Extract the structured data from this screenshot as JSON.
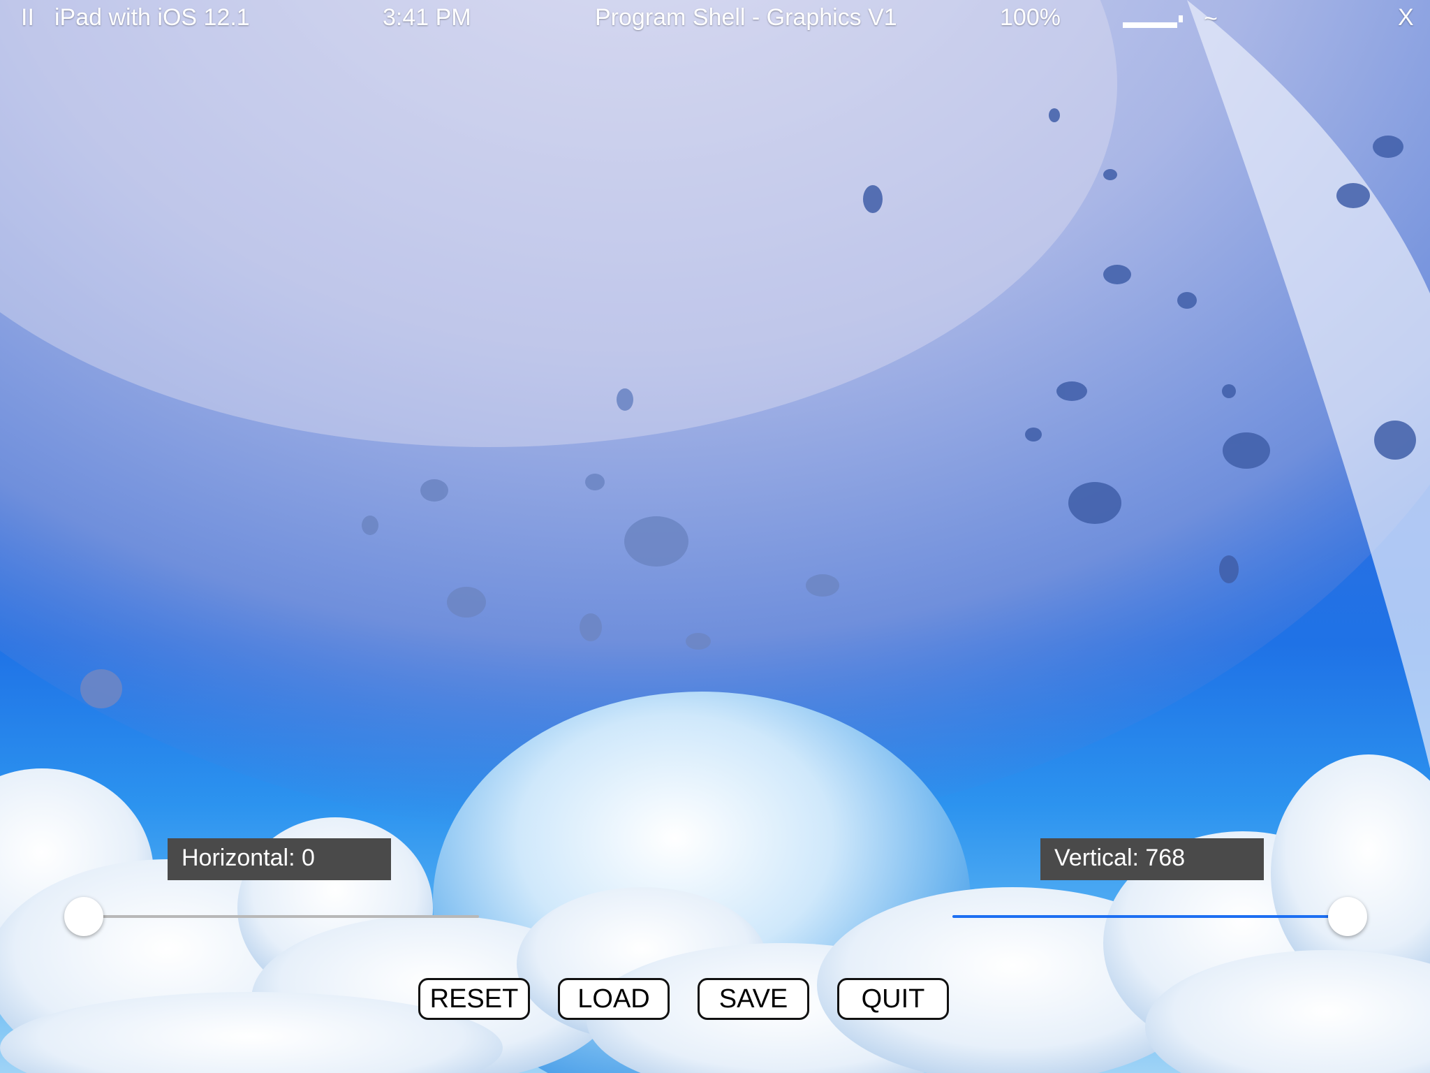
{
  "status_bar": {
    "pause": "II",
    "device": "iPad with iOS 12.1",
    "time": "3:41 PM",
    "title": "Program Shell - Graphics V1",
    "battery_percent": "100%",
    "wifi": "~",
    "close": "X"
  },
  "controls": {
    "horizontal": {
      "label": "Horizontal: 0",
      "value": 0,
      "level": 0.0
    },
    "vertical": {
      "label": "Vertical: 768",
      "value": 768,
      "level": 1.0
    }
  },
  "buttons": {
    "reset": "RESET",
    "load": "LOAD",
    "save": "SAVE",
    "quit": "QUIT"
  },
  "colors": {
    "sky_top": "#4a7fd6",
    "sky_bottom": "#9fd3f6",
    "label_bg": "#4a4a4a",
    "slider_active": "#1d6ff2",
    "slider_inactive": "#b8b8b8"
  }
}
